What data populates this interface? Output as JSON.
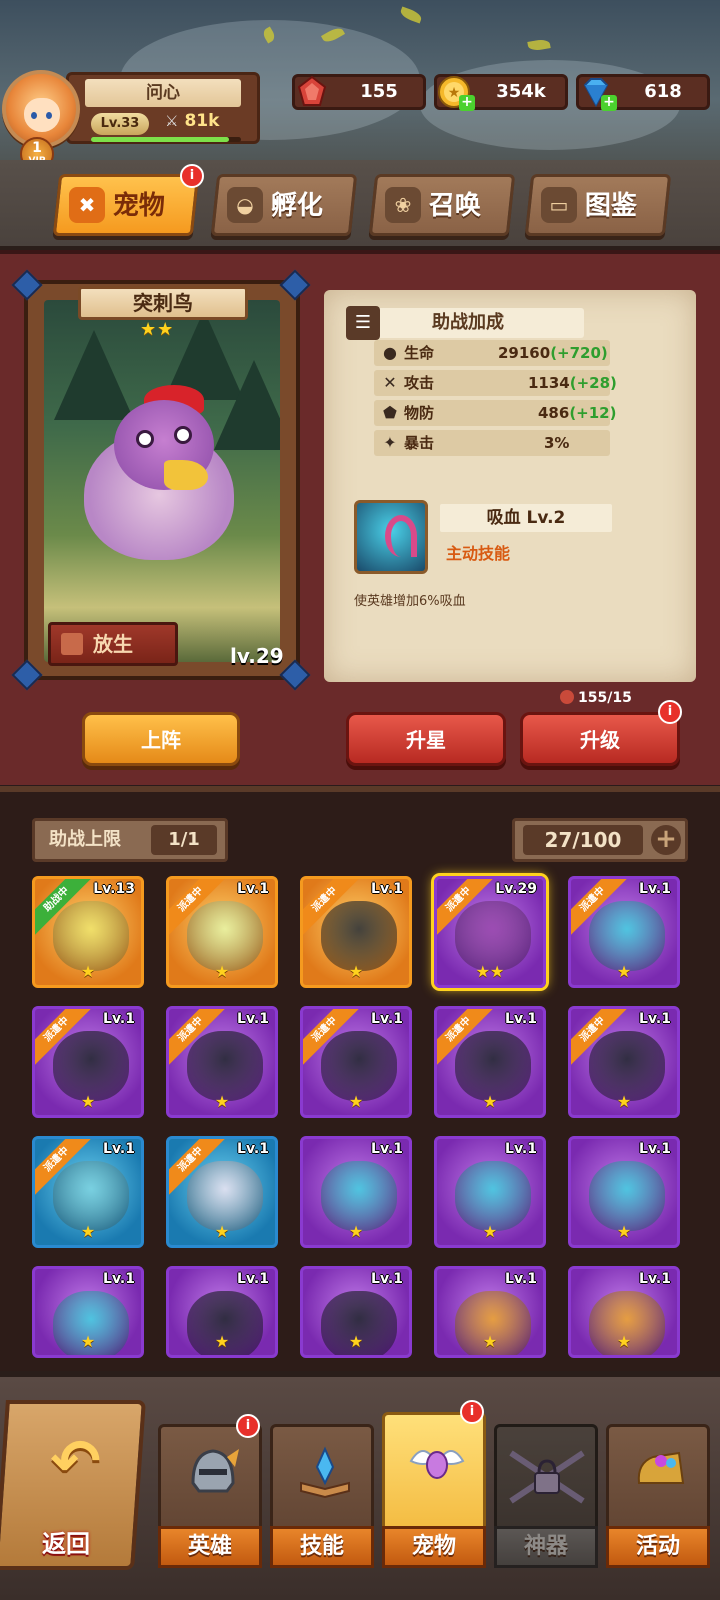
{
  "player": {
    "name": "问心",
    "level": "Lv.33",
    "power": "81k",
    "vip_level": "1",
    "vip_label": "VIP",
    "xp_fraction": 0.92
  },
  "resources": [
    {
      "name": "stamina",
      "icon": "ruby-icon",
      "value": "155",
      "color": "#d8443a"
    },
    {
      "name": "gold",
      "icon": "gold-coin-icon",
      "value": "354k",
      "color": "#f5b82a",
      "has_plus": true
    },
    {
      "name": "diamond",
      "icon": "diamond-icon",
      "value": "618",
      "color": "#4ab0f0",
      "has_plus": true
    }
  ],
  "category_tabs": [
    {
      "label": "宠物",
      "icon": "paw-face-icon",
      "active": true,
      "badge": "i"
    },
    {
      "label": "孵化",
      "icon": "egg-icon",
      "active": false
    },
    {
      "label": "召唤",
      "icon": "paw-icon",
      "active": false
    },
    {
      "label": "图鉴",
      "icon": "book-icon",
      "active": false
    }
  ],
  "pet": {
    "name": "突刺鸟",
    "stars": "★★",
    "level": "lv.29",
    "release_label": "放生"
  },
  "assist": {
    "title": "助战加成",
    "stats": [
      {
        "icon": "blood-drop-icon",
        "label": "生命",
        "value": "29160",
        "bonus": "(+720)"
      },
      {
        "icon": "sword-icon",
        "label": "攻击",
        "value": "1134",
        "bonus": "(+28)"
      },
      {
        "icon": "shield-icon",
        "label": "物防",
        "value": "486",
        "bonus": "(+12)"
      },
      {
        "icon": "crit-icon",
        "label": "暴击",
        "value": "3%",
        "bonus": ""
      }
    ],
    "skill": {
      "name": "吸血 Lv.2",
      "type": "主动技能",
      "description": "使英雄增加6%吸血"
    }
  },
  "upgrade_material": "155/15",
  "actions": {
    "deploy": "上阵",
    "star_up": "升星",
    "level_up": "升级",
    "level_up_badge": "i"
  },
  "collection": {
    "assist_limit_label": "助战上限",
    "assist_limit_value": "1/1",
    "capacity": "27/100",
    "pets": [
      {
        "level": "Lv.13",
        "rarity": "orange",
        "ribbon": "助战中",
        "ribbon_style": "green",
        "stars": "★",
        "creature_color": "#f0e06a"
      },
      {
        "level": "Lv.1",
        "rarity": "orange",
        "ribbon": "派遣中",
        "ribbon_style": "orange",
        "stars": "★",
        "creature_color": "#e8f0a0"
      },
      {
        "level": "Lv.1",
        "rarity": "orange",
        "ribbon": "派遣中",
        "ribbon_style": "orange",
        "stars": "★",
        "creature_color": "#3a3a3a"
      },
      {
        "level": "Lv.29",
        "rarity": "purple",
        "ribbon": "派遣中",
        "ribbon_style": "orange",
        "stars": "★★",
        "creature_color": "#9a4ab0",
        "selected": true
      },
      {
        "level": "Lv.1",
        "rarity": "purple",
        "ribbon": "派遣中",
        "ribbon_style": "orange",
        "stars": "★",
        "creature_color": "#4ac8e0"
      },
      {
        "level": "Lv.1",
        "rarity": "purple",
        "ribbon": "派遣中",
        "ribbon_style": "orange",
        "stars": "★",
        "creature_color": "#2a2a3a"
      },
      {
        "level": "Lv.1",
        "rarity": "purple",
        "ribbon": "派遣中",
        "ribbon_style": "orange",
        "stars": "★",
        "creature_color": "#2a2a3a"
      },
      {
        "level": "Lv.1",
        "rarity": "purple",
        "ribbon": "派遣中",
        "ribbon_style": "orange",
        "stars": "★",
        "creature_color": "#2a2a3a"
      },
      {
        "level": "Lv.1",
        "rarity": "purple",
        "ribbon": "派遣中",
        "ribbon_style": "orange",
        "stars": "★",
        "creature_color": "#2a2a3a"
      },
      {
        "level": "Lv.1",
        "rarity": "purple",
        "ribbon": "派遣中",
        "ribbon_style": "orange",
        "stars": "★",
        "creature_color": "#2a2a3a"
      },
      {
        "level": "Lv.1",
        "rarity": "blue",
        "ribbon": "派遣中",
        "ribbon_style": "orange",
        "stars": "★",
        "creature_color": "#7ad0e0"
      },
      {
        "level": "Lv.1",
        "rarity": "blue",
        "ribbon": "派遣中",
        "ribbon_style": "orange",
        "stars": "★",
        "creature_color": "#e0e0f0"
      },
      {
        "level": "Lv.1",
        "rarity": "purple",
        "ribbon": "",
        "stars": "★",
        "creature_color": "#4ac8e0"
      },
      {
        "level": "Lv.1",
        "rarity": "purple",
        "ribbon": "",
        "stars": "★",
        "creature_color": "#4ac8e0"
      },
      {
        "level": "Lv.1",
        "rarity": "purple",
        "ribbon": "",
        "stars": "★",
        "creature_color": "#4ac8e0"
      },
      {
        "level": "Lv.1",
        "rarity": "purple",
        "ribbon": "",
        "stars": "★",
        "creature_color": "#4ac8e0"
      },
      {
        "level": "Lv.1",
        "rarity": "purple",
        "ribbon": "",
        "stars": "★",
        "creature_color": "#2a2a3a"
      },
      {
        "level": "Lv.1",
        "rarity": "purple",
        "ribbon": "",
        "stars": "★",
        "creature_color": "#2a2a3a"
      },
      {
        "level": "Lv.1",
        "rarity": "purple",
        "ribbon": "",
        "stars": "★",
        "creature_color": "#e8a03a"
      },
      {
        "level": "Lv.1",
        "rarity": "purple",
        "ribbon": "",
        "stars": "★",
        "creature_color": "#e8a03a"
      }
    ]
  },
  "bottom_nav": {
    "back_label": "返回",
    "items": [
      {
        "label": "英雄",
        "icon": "helmet-icon",
        "badge": "i"
      },
      {
        "label": "技能",
        "icon": "spellbook-icon"
      },
      {
        "label": "宠物",
        "icon": "winged-egg-icon",
        "active": true,
        "badge": "i"
      },
      {
        "label": "神器",
        "icon": "locked-chain-icon",
        "locked": true
      },
      {
        "label": "活动",
        "icon": "treasure-horn-icon"
      }
    ]
  }
}
